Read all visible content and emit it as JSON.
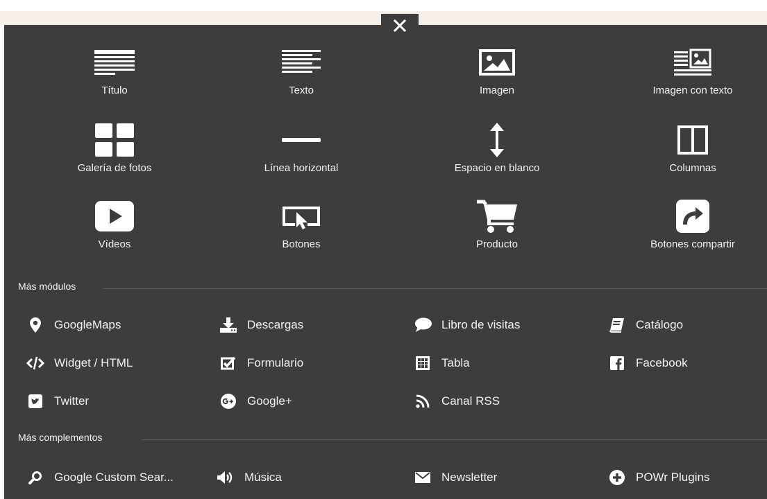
{
  "close_icon": "close-icon",
  "modules": [
    {
      "label": "Título",
      "icon": "title-icon"
    },
    {
      "label": "Texto",
      "icon": "text-icon"
    },
    {
      "label": "Imagen",
      "icon": "image-icon"
    },
    {
      "label": "Imagen con texto",
      "icon": "image-text-icon"
    },
    {
      "label": "Galería de fotos",
      "icon": "gallery-icon"
    },
    {
      "label": "Línea horizontal",
      "icon": "horizontal-line-icon"
    },
    {
      "label": "Espacio en blanco",
      "icon": "vertical-arrows-icon"
    },
    {
      "label": "Columnas",
      "icon": "columns-icon"
    },
    {
      "label": "Vídeos",
      "icon": "play-icon"
    },
    {
      "label": "Botones",
      "icon": "button-cursor-icon"
    },
    {
      "label": "Producto",
      "icon": "cart-icon"
    },
    {
      "label": "Botones compartir",
      "icon": "share-icon"
    }
  ],
  "more_modules": {
    "title": "Más módulos",
    "items": [
      {
        "label": "GoogleMaps",
        "icon": "map-pin-icon"
      },
      {
        "label": "Descargas",
        "icon": "download-icon"
      },
      {
        "label": "Libro de visitas",
        "icon": "speech-bubble-icon"
      },
      {
        "label": "Catálogo",
        "icon": "book-icon"
      },
      {
        "label": "Widget / HTML",
        "icon": "code-icon"
      },
      {
        "label": "Formulario",
        "icon": "checkbox-icon"
      },
      {
        "label": "Tabla",
        "icon": "table-icon"
      },
      {
        "label": "Facebook",
        "icon": "facebook-icon"
      },
      {
        "label": "Twitter",
        "icon": "twitter-icon"
      },
      {
        "label": "Google+",
        "icon": "google-plus-icon"
      },
      {
        "label": "Canal RSS",
        "icon": "rss-icon"
      }
    ]
  },
  "more_addons": {
    "title": "Más complementos",
    "items": [
      {
        "label": "Google Custom Sear...",
        "icon": "search-icon"
      },
      {
        "label": "Música",
        "icon": "speaker-icon"
      },
      {
        "label": "Newsletter",
        "icon": "envelope-icon"
      },
      {
        "label": "POWr Plugins",
        "icon": "plus-circle-icon"
      }
    ]
  },
  "colors": {
    "panel": "#3d3d3d",
    "text": "#ffffff",
    "topband": "#f6efea"
  }
}
